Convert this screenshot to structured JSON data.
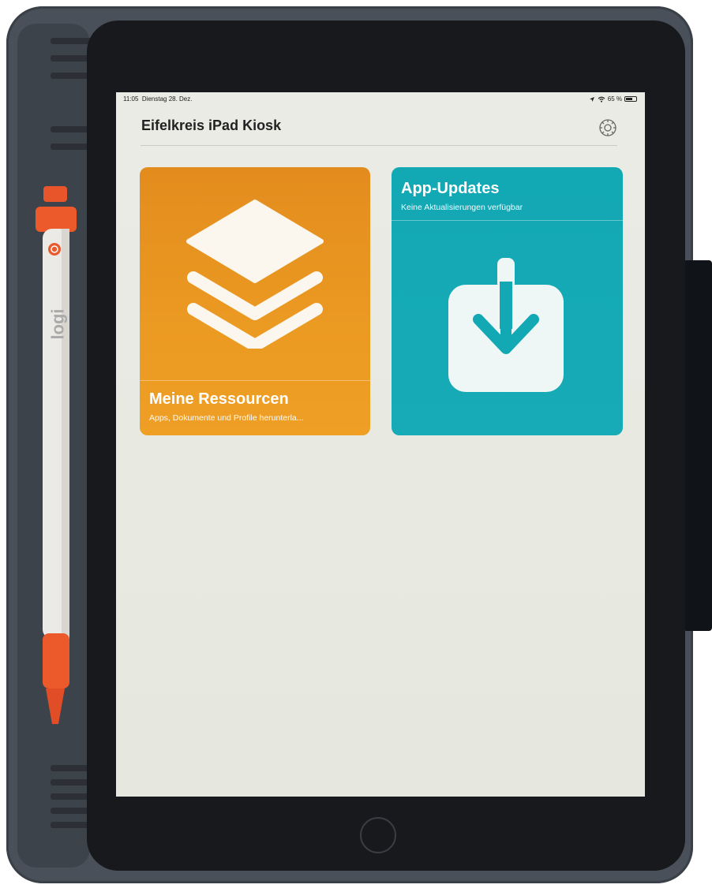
{
  "status_bar": {
    "time": "11:05",
    "date": "Dienstag 28. Dez.",
    "battery": "65 %",
    "battery_level": 0.65,
    "icons": [
      "location-icon",
      "wifi-icon",
      "battery-icon"
    ]
  },
  "header": {
    "title": "Eifelkreis iPad Kiosk",
    "settings_icon": "settings-icon"
  },
  "tiles": [
    {
      "title": "Meine Ressourcen",
      "subtitle": "Apps, Dokumente und Profile herunterla...",
      "icon": "layers-icon",
      "color": "#e8941f"
    },
    {
      "title": "App-Updates",
      "subtitle": "Keine Aktualisierungen verfügbar",
      "icon": "download-icon",
      "color": "#14a9b5"
    }
  ],
  "device": {
    "stylus_brand": "logi",
    "home_button": "home-button"
  }
}
